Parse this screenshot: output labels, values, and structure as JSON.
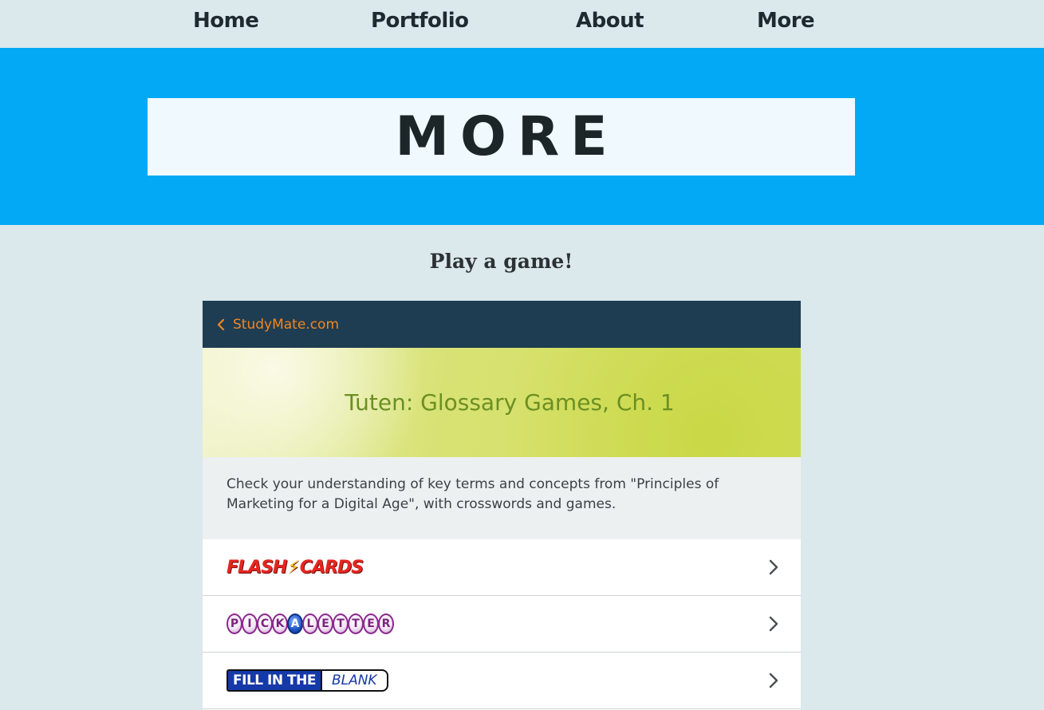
{
  "nav": {
    "items": [
      {
        "label": "Home"
      },
      {
        "label": "Portfolio"
      },
      {
        "label": "About"
      },
      {
        "label": "More"
      }
    ]
  },
  "hero": {
    "title": "MORE"
  },
  "section": {
    "subtitle": "Play a game!"
  },
  "widget": {
    "back_label": "StudyMate.com",
    "title": "Tuten: Glossary Games, Ch. 1",
    "description": "Check your understanding of key terms and concepts from \"Principles of Marketing for a Digital Age\", with crosswords and games.",
    "games": [
      {
        "name": "FLASH CARDS",
        "parts": [
          "FLASH",
          "CARDS"
        ]
      },
      {
        "name": "PICK A LETTER",
        "letters": [
          "P",
          "I",
          "C",
          "K",
          "A",
          "L",
          "E",
          "T",
          "T",
          "E",
          "R"
        ],
        "highlight_index": 4
      },
      {
        "name": "FILL IN THE BLANK",
        "parts": [
          "FILL IN THE",
          "BLANK"
        ]
      }
    ]
  },
  "colors": {
    "page_bg": "#dbe8ec",
    "hero_bg": "#03a9f4",
    "widget_header_bg": "#1e3d52",
    "accent_orange": "#f5861f",
    "banner_title": "#6b8f22"
  }
}
